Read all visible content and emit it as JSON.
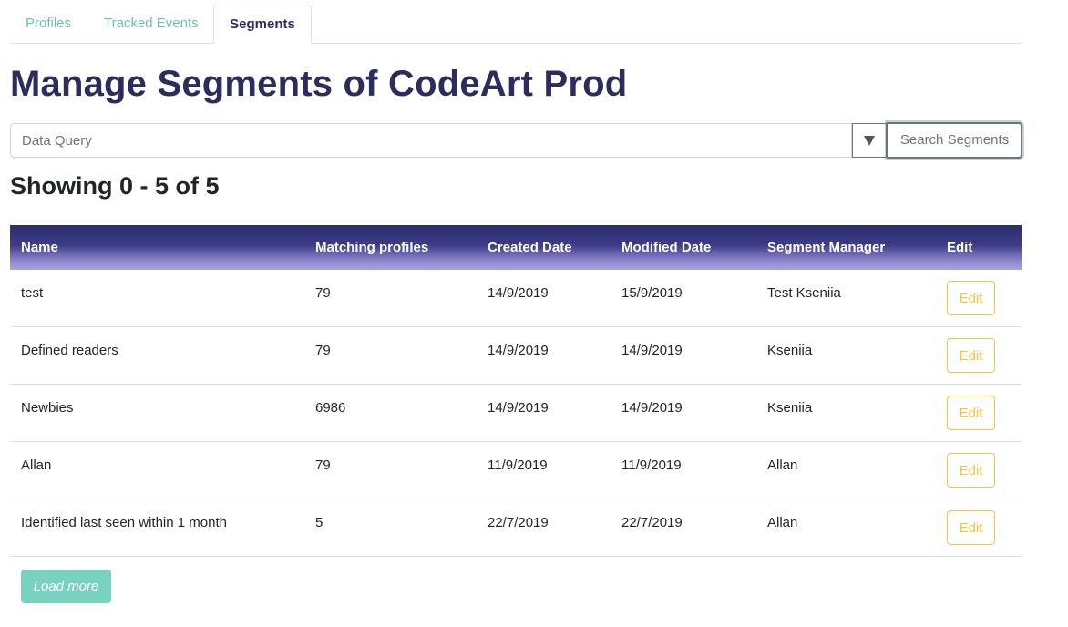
{
  "tabs": [
    {
      "label": "Profiles"
    },
    {
      "label": "Tracked Events"
    },
    {
      "label": "Segments"
    }
  ],
  "title": "Manage Segments of CodeArt Prod",
  "query": {
    "placeholder": "Data Query",
    "value": "",
    "filter_icon": "triangle-down-icon",
    "search_label": "Search Segments"
  },
  "showing": "Showing 0 - 5 of 5",
  "table": {
    "headers": {
      "name": "Name",
      "matching": "Matching profiles",
      "created": "Created Date",
      "modified": "Modified Date",
      "manager": "Segment Manager",
      "edit": "Edit"
    },
    "rows": [
      {
        "name": "test",
        "matching": "79",
        "created": "14/9/2019",
        "modified": "15/9/2019",
        "manager": "Test Kseniia",
        "edit": "Edit"
      },
      {
        "name": "Defined readers",
        "matching": "79",
        "created": "14/9/2019",
        "modified": "14/9/2019",
        "manager": "Kseniia",
        "edit": "Edit"
      },
      {
        "name": "Newbies",
        "matching": "6986",
        "created": "14/9/2019",
        "modified": "14/9/2019",
        "manager": "Kseniia",
        "edit": "Edit"
      },
      {
        "name": "Allan",
        "matching": "79",
        "created": "11/9/2019",
        "modified": "11/9/2019",
        "manager": "Allan",
        "edit": "Edit"
      },
      {
        "name": "Identified last seen within 1 month",
        "matching": "5",
        "created": "22/7/2019",
        "modified": "22/7/2019",
        "manager": "Allan",
        "edit": "Edit"
      }
    ]
  },
  "load_more": "Load more",
  "colors": {
    "accent_teal": "#6cc3b3",
    "title_navy": "#2c2c5e",
    "edit_yellow": "#f5c242",
    "load_more_bg": "#79d1bf"
  }
}
